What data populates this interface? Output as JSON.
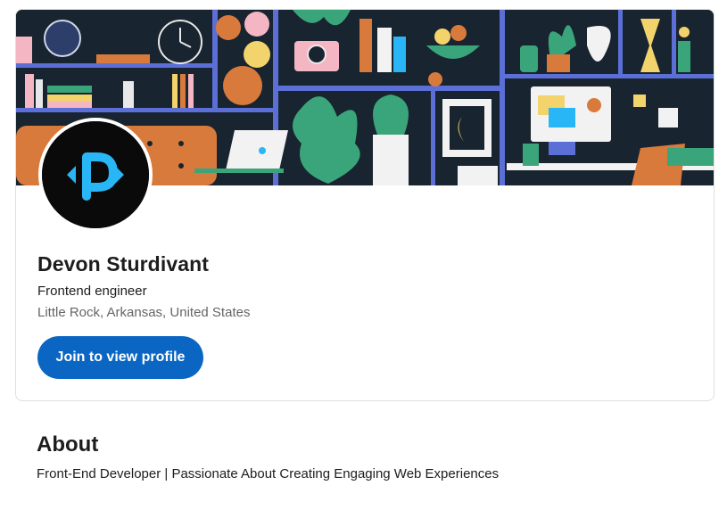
{
  "profile": {
    "name": "Devon Sturdivant",
    "headline": "Frontend engineer",
    "location": "Little Rock, Arkansas, United States",
    "join_button_label": "Join to view profile",
    "avatar_icon": "dp-logo-icon"
  },
  "banner": {
    "illustration": "workspace-shelves-illustration"
  },
  "about": {
    "title": "About",
    "text": "Front-End Developer | Passionate About Creating Engaging Web Experiences"
  },
  "colors": {
    "accent": "#0a66c2",
    "banner_bg": "#18242f",
    "logo_blue": "#29b6f6"
  }
}
